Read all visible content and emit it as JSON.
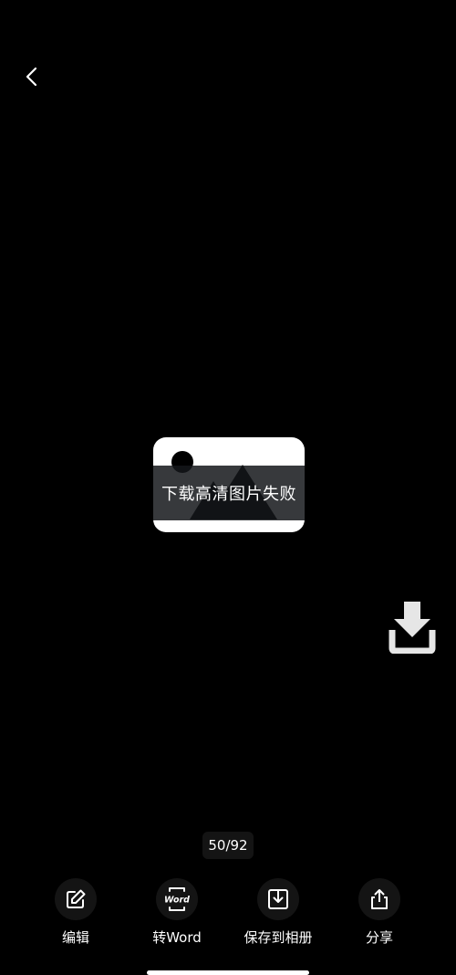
{
  "nav": {
    "back_icon": "chevron-left-icon"
  },
  "image_viewer": {
    "placeholder_icon": "broken-image-icon",
    "error_toast": "下载高清图片失败",
    "download_icon": "download-icon"
  },
  "pager": {
    "current": 50,
    "total": 92,
    "label": "50/92"
  },
  "toolbar": {
    "items": [
      {
        "label": "编辑",
        "icon": "edit-icon"
      },
      {
        "label": "转Word",
        "icon": "word-icon"
      },
      {
        "label": "保存到相册",
        "icon": "save-to-album-icon"
      },
      {
        "label": "分享",
        "icon": "share-icon"
      }
    ],
    "word_badge": "Word"
  },
  "colors": {
    "background": "#000000",
    "button_bg": "#141414",
    "foreground": "#ffffff"
  }
}
